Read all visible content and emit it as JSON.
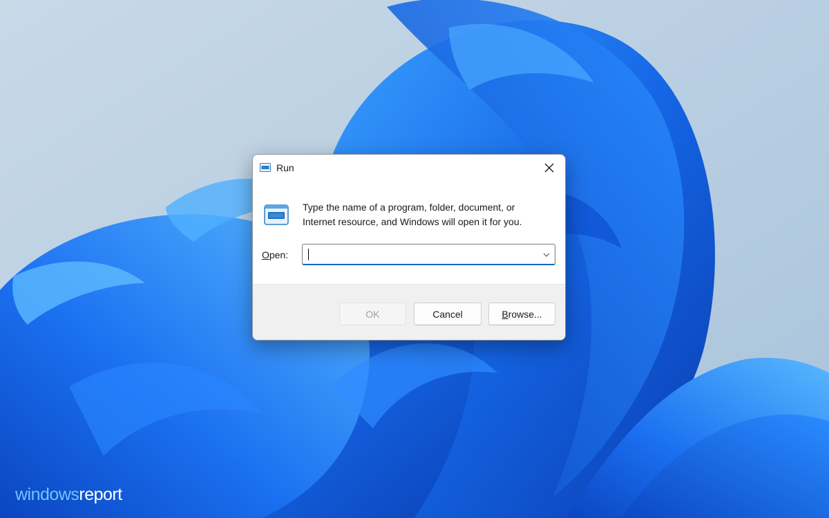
{
  "theme": {
    "accent": "#0067c0",
    "wallpaper_light": "#c3d6e6",
    "wallpaper_blue": "#1565e8",
    "wallpaper_deep": "#0a3fb5"
  },
  "dialog": {
    "title": "Run",
    "title_icon": "run-icon",
    "close_icon": "close-icon",
    "description_line1": "Type the name of a program, folder, document, or",
    "description_line2": "Internet resource, and Windows will open it for you.",
    "open_label_mnemonic": "O",
    "open_label_rest": "pen:",
    "combo_value": "",
    "combo_icon": "chevron-down-icon",
    "buttons": {
      "ok": "OK",
      "cancel": "Cancel",
      "browse_mnemonic": "B",
      "browse_rest": "rowse..."
    }
  },
  "watermark": {
    "part1": "windows",
    "part2": "report"
  }
}
